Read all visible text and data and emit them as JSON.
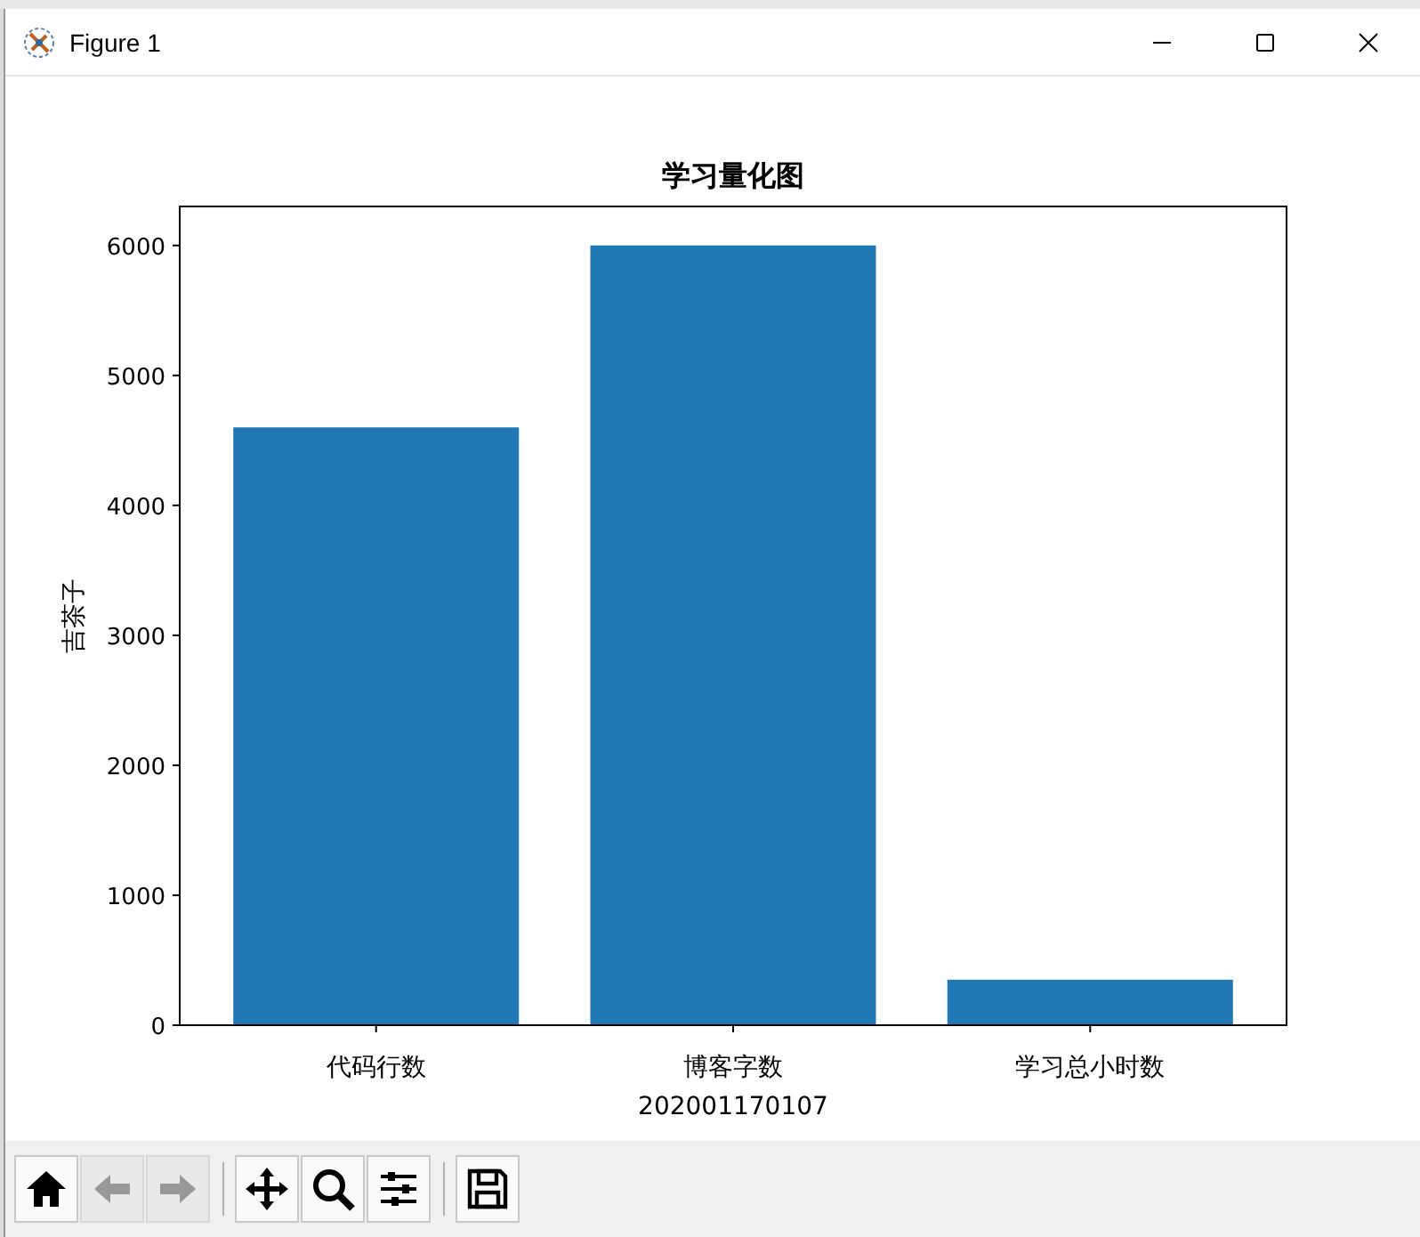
{
  "window": {
    "title": "Figure 1"
  },
  "figure": {
    "chart_data": {
      "type": "bar",
      "title": "学习量化图",
      "xlabel": "202001170107",
      "ylabel": "吉茶子",
      "categories": [
        "代码行数",
        "博客字数",
        "学习总小时数"
      ],
      "series": [
        {
          "color": "#1f77b4",
          "values": [
            4600,
            6000,
            350
          ]
        }
      ],
      "ylim": [
        0,
        6300
      ],
      "yticks": [
        0,
        1000,
        2000,
        3000,
        4000,
        5000,
        6000
      ]
    }
  },
  "toolbar": [
    {
      "kind": "home",
      "disabled": false
    },
    {
      "kind": "back",
      "disabled": true
    },
    {
      "kind": "forward",
      "disabled": true
    },
    {
      "kind": "separator"
    },
    {
      "kind": "pan",
      "disabled": false
    },
    {
      "kind": "zoom",
      "disabled": false
    },
    {
      "kind": "configure",
      "disabled": false
    },
    {
      "kind": "separator"
    },
    {
      "kind": "save",
      "disabled": false
    }
  ]
}
